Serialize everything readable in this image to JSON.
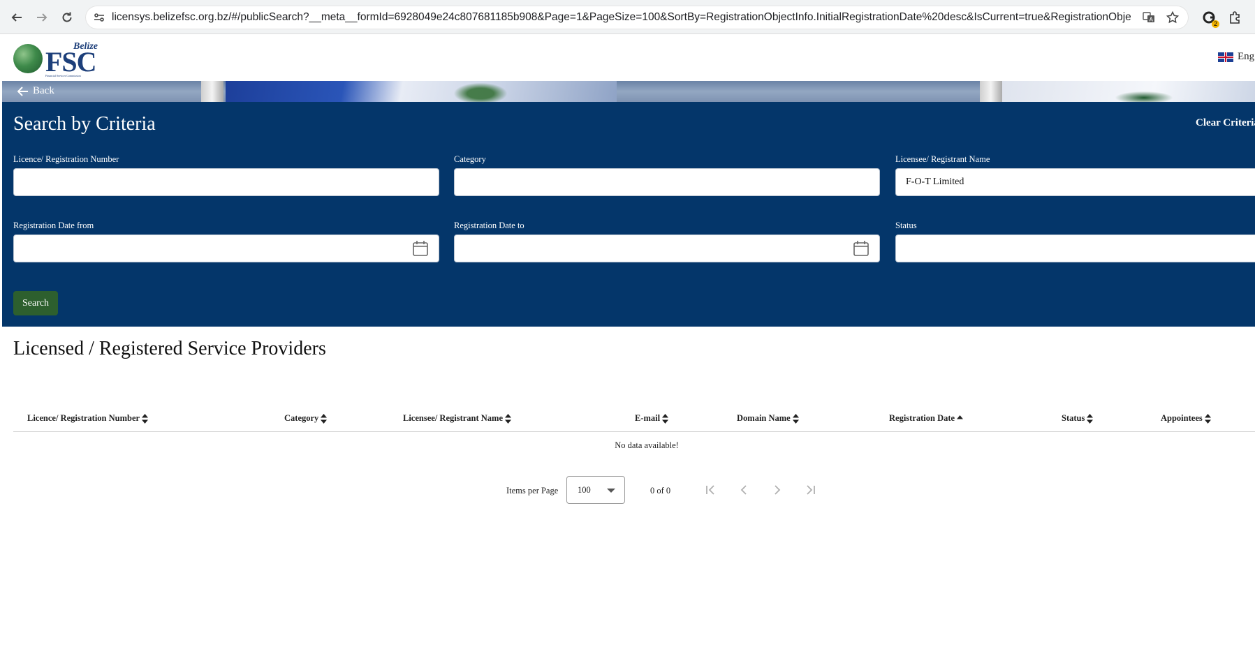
{
  "browser": {
    "url": "licensys.belizefsc.org.bz/#/publicSearch?__meta__formId=6928049e24c807681185b908&Page=1&PageSize=100&SortBy=RegistrationObjectInfo.InitialRegistrationDate%20desc&IsCurrent=true&RegistrationObjectInfo...",
    "extension_badge": "2",
    "icons": [
      "back-arrow-icon",
      "forward-arrow-icon",
      "reload-icon",
      "site-settings-icon",
      "translate-icon",
      "star-icon",
      "extension-icon",
      "puzzle-icon"
    ]
  },
  "header": {
    "logo_top": "Belize",
    "logo_main": "FSC",
    "logo_tagline": "Financial Services Commission",
    "language": "Eng"
  },
  "banner": {
    "back_label": "Back"
  },
  "search": {
    "title": "Search by Criteria",
    "clear_label": "Clear Criteria",
    "fields": {
      "licence_number": {
        "label": "Licence/ Registration Number",
        "value": ""
      },
      "category": {
        "label": "Category",
        "value": ""
      },
      "licensee_name": {
        "label": "Licensee/ Registrant Name",
        "value": "F-O-T Limited"
      },
      "date_from": {
        "label": "Registration Date from",
        "value": ""
      },
      "date_to": {
        "label": "Registration Date to",
        "value": ""
      },
      "status": {
        "label": "Status",
        "value": ""
      }
    },
    "search_label": "Search"
  },
  "results": {
    "title": "Licensed / Registered Service Providers",
    "columns": [
      "Licence/ Registration Number",
      "Category",
      "Licensee/ Registrant Name",
      "E-mail",
      "Domain Name",
      "Registration Date",
      "Status",
      "Appointees"
    ],
    "sorted_column": "Registration Date",
    "empty_text": "No data available!"
  },
  "pagination": {
    "items_per_page_label": "Items per Page",
    "items_per_page_value": "100",
    "range_text": "0 of 0"
  },
  "colors": {
    "panel_bg": "#04366a",
    "search_button": "#2d5f2e",
    "logo_blue": "#1d3f7a"
  }
}
